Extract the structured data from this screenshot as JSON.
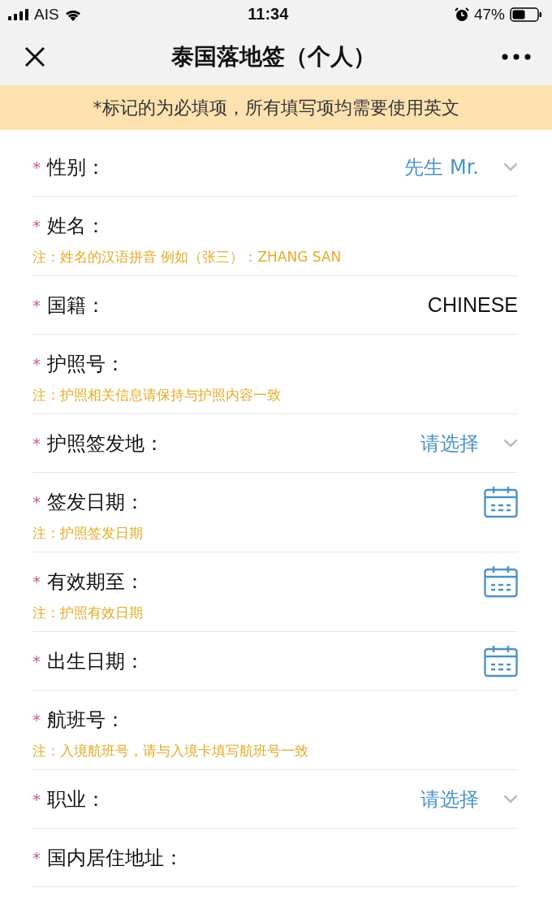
{
  "status_bar": {
    "carrier": "AIS",
    "time": "11:34",
    "battery": "47%"
  },
  "nav": {
    "title": "泰国落地签（个人）"
  },
  "banner": "*标记的为必填项，所有填写项均需要使用英文",
  "fields": [
    {
      "kind": "select",
      "mark": "*",
      "label": "性别：",
      "value": "先生 Mr."
    },
    {
      "kind": "text",
      "mark": "*",
      "label": "姓名：",
      "note": "注：姓名的汉语拼音 例如（张三）：ZHANG SAN"
    },
    {
      "kind": "text",
      "mark": "*",
      "label": "国籍：",
      "value": "CHINESE"
    },
    {
      "kind": "text",
      "mark": "*",
      "label": "护照号：",
      "note": "注：护照相关信息请保持与护照内容一致"
    },
    {
      "kind": "select",
      "mark": "*",
      "label": "护照签发地：",
      "value": "请选择"
    },
    {
      "kind": "date",
      "mark": "*",
      "label": "签发日期：",
      "note": "注：护照签发日期"
    },
    {
      "kind": "date",
      "mark": "*",
      "label": "有效期至：",
      "note": "注：护照有效日期"
    },
    {
      "kind": "date",
      "mark": "*",
      "label": "出生日期："
    },
    {
      "kind": "text",
      "mark": "*",
      "label": "航班号：",
      "note": "注：入境航班号，请与入境卡填写航班号一致"
    },
    {
      "kind": "select",
      "mark": "*",
      "label": "职业：",
      "value": "请选择"
    },
    {
      "kind": "text",
      "mark": "*",
      "label": "国内居住地址："
    }
  ]
}
